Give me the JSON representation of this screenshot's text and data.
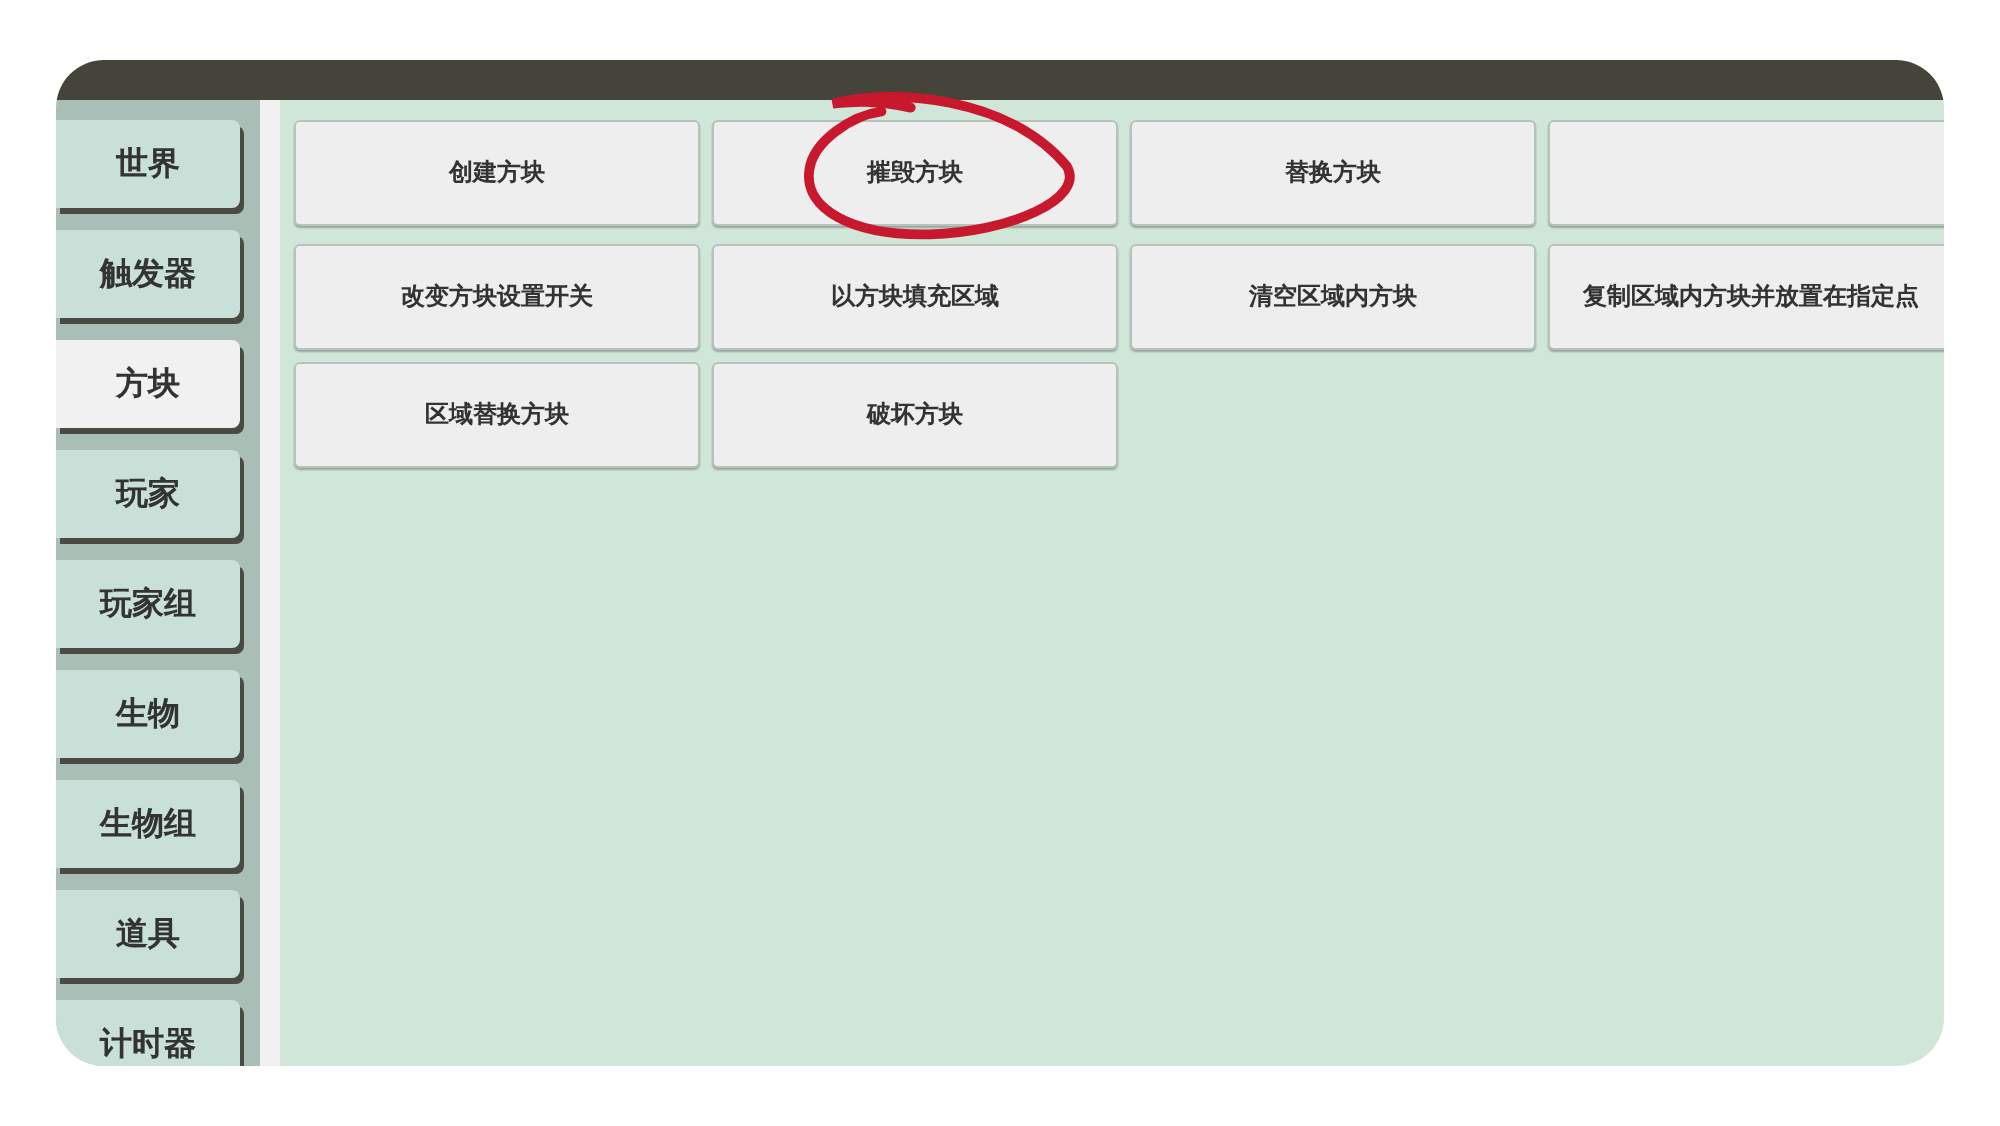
{
  "sidebar": {
    "items": [
      {
        "label": "世界",
        "selected": false
      },
      {
        "label": "触发器",
        "selected": false
      },
      {
        "label": "方块",
        "selected": true
      },
      {
        "label": "玩家",
        "selected": false
      },
      {
        "label": "玩家组",
        "selected": false
      },
      {
        "label": "生物",
        "selected": false
      },
      {
        "label": "生物组",
        "selected": false
      },
      {
        "label": "道具",
        "selected": false
      },
      {
        "label": "计时器",
        "selected": false
      }
    ]
  },
  "actions": [
    {
      "label": "创建方块",
      "circled": false
    },
    {
      "label": "摧毁方块",
      "circled": true
    },
    {
      "label": "替换方块",
      "circled": false
    },
    {
      "circled": false
    },
    {
      "label": "改变方块设置开关",
      "circled": false
    },
    {
      "label": "以方块填充区域",
      "circled": false
    },
    {
      "label": "清空区域内方块",
      "circled": false
    },
    {
      "label": "复制区域内方块并放置在指定点",
      "circled": false
    },
    {
      "label": "区域替换方块",
      "circled": false
    },
    {
      "label": "破坏方块",
      "circled": false
    }
  ]
}
